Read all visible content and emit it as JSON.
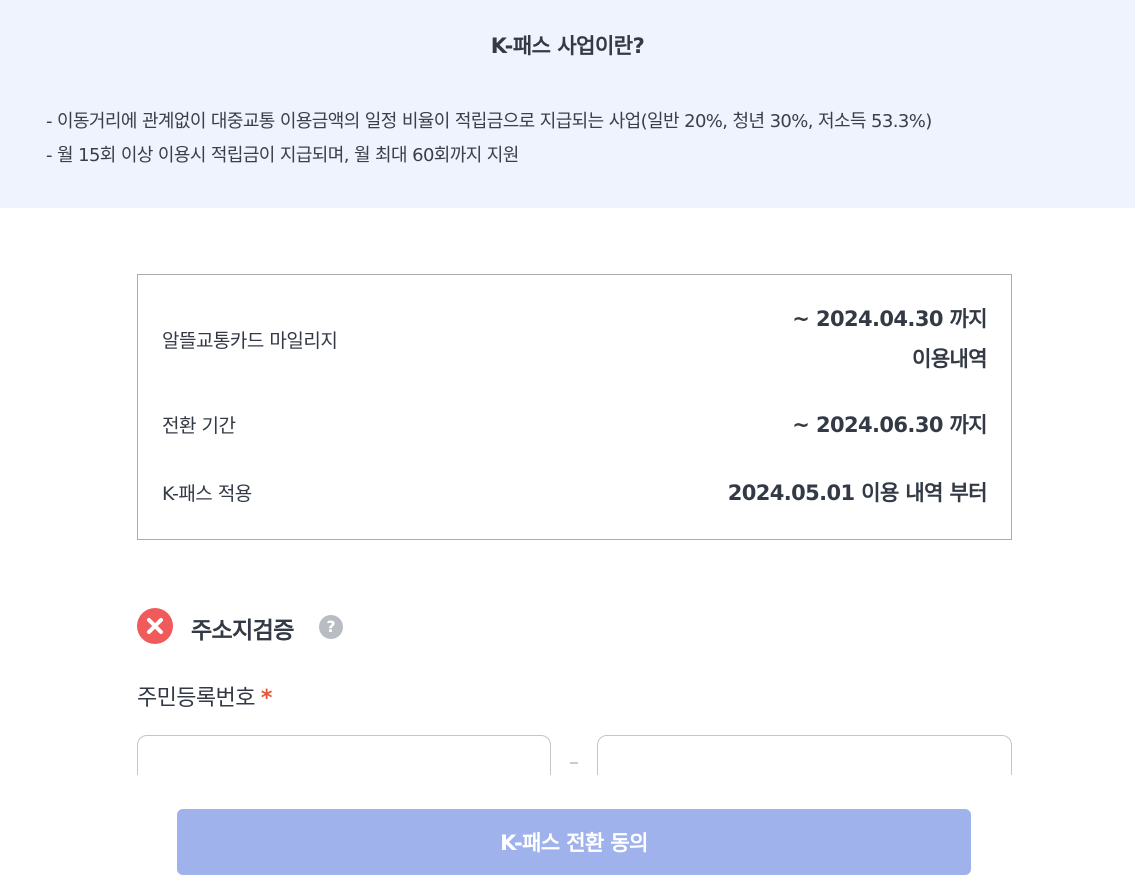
{
  "info": {
    "title": "K-패스 사업이란?",
    "lines": [
      "- 이동거리에 관계없이 대중교통 이용금액의 일정 비율이 적립금으로 지급되는 사업(일반 20%, 청년 30%, 저소득 53.3%)",
      "- 월 15회 이상 이용시 적립금이 지급되며, 월 최대 60회까지 지원"
    ]
  },
  "period": {
    "mileage_label": "알뜰교통카드 마일리지",
    "mileage_value_line1": "~ 2024.04.30 까지",
    "mileage_value_line2": "이용내역",
    "conversion_label": "전환 기간",
    "conversion_value": "~ 2024.06.30 까지",
    "kpass_label": "K-패스 적용",
    "kpass_value": "2024.05.01 이용 내역 부터"
  },
  "verification": {
    "label": "주소지검증",
    "status_icon": "x-circle-icon",
    "status_color": "#f05a5a",
    "help_icon": "question-circle-icon",
    "help_glyph": "?"
  },
  "rrn": {
    "label": "주민등록번호",
    "required_mark": "*",
    "front_value": "",
    "back_value": ""
  },
  "button": {
    "agree_label": "K-패스 전환 동의",
    "color": "#9fb2ec"
  }
}
